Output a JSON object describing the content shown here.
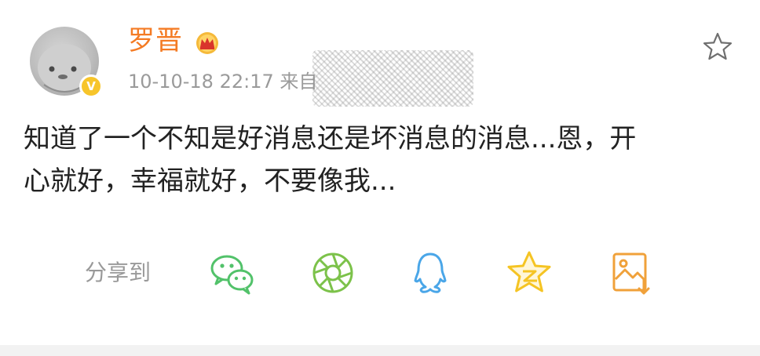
{
  "post": {
    "username": "罗晋",
    "meta": "10-10-18 22:17  来自",
    "text_line1": "知道了一个不知是好消息还是坏消息的消息...恩，开",
    "text_line2": "心就好，幸福就好，不要像我..."
  },
  "badges": {
    "verified": "V"
  },
  "share": {
    "label": "分享到",
    "targets": [
      "wechat-icon",
      "moments-icon",
      "qq-icon",
      "qzone-icon",
      "save-image-icon"
    ]
  },
  "colors": {
    "username": "#f47b24",
    "meta": "#9a9a9a",
    "text": "#222222",
    "share_green": "#52c26a",
    "share_blue": "#4aa6e8",
    "share_yellow": "#f5c423",
    "verified": "#f7c52b"
  }
}
